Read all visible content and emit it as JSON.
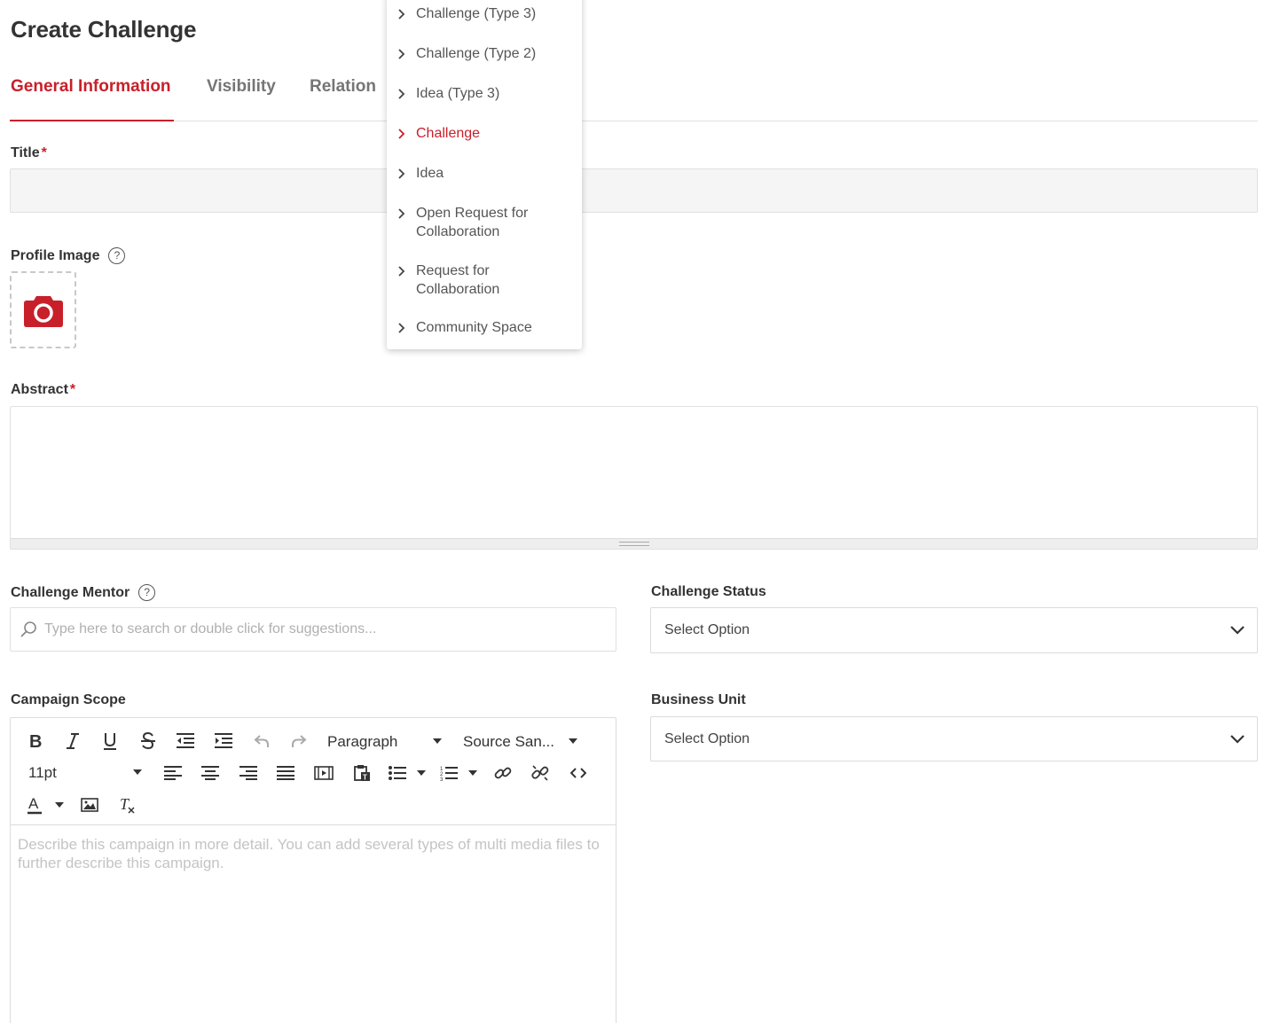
{
  "page": {
    "title": "Create Challenge"
  },
  "tabs": [
    {
      "label": "General Information",
      "active": true
    },
    {
      "label": "Visibility",
      "active": false
    },
    {
      "label": "Relation",
      "active": false
    }
  ],
  "form": {
    "title_label": "Title",
    "required_mark": "*",
    "profile_image_label": "Profile Image",
    "help_glyph": "?",
    "abstract_label": "Abstract",
    "mentor_label": "Challenge Mentor",
    "mentor_placeholder": "Type here to search or double click for suggestions...",
    "status_label": "Challenge Status",
    "status_value": "Select Option",
    "scope_label": "Campaign Scope",
    "business_unit_label": "Business Unit",
    "business_unit_value": "Select Option"
  },
  "editor": {
    "block_format": "Paragraph",
    "font_family": "Source San...",
    "font_size": "11pt",
    "placeholder": "Describe this campaign in more detail. You can add several types of multi media files to further describe this campaign.",
    "text_color_glyph": "A",
    "clear_format_glyph": "T"
  },
  "type_dropdown": {
    "items": [
      {
        "label": "Challenge (Type 3)",
        "selected": false
      },
      {
        "label": "Challenge (Type 2)",
        "selected": false
      },
      {
        "label": "Idea (Type 3)",
        "selected": false
      },
      {
        "label": "Challenge",
        "selected": true
      },
      {
        "label": "Idea",
        "selected": false
      },
      {
        "label": "Open Request for Collaboration",
        "selected": false
      },
      {
        "label": "Request for Collaboration",
        "selected": false
      },
      {
        "label": "Community Space",
        "selected": false
      }
    ]
  },
  "colors": {
    "accent": "#c8202a",
    "text": "#333333",
    "muted": "#757575",
    "border": "#e0e0e0"
  }
}
